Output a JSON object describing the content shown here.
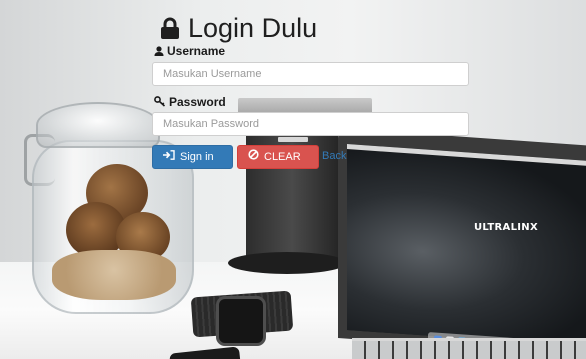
{
  "login": {
    "title": "Login Dulu",
    "title_icon": "lock-icon",
    "username": {
      "label": "Username",
      "icon": "user-icon",
      "placeholder": "Masukan Username",
      "value": ""
    },
    "password": {
      "label": "Password",
      "icon": "key-icon",
      "placeholder": "Masukan Password",
      "value": ""
    },
    "buttons": {
      "signin_label": "Sign in",
      "signin_icon": "sign-in-icon",
      "clear_label": "CLEAR",
      "clear_icon": "ban-icon",
      "back_label": "Back"
    }
  },
  "background": {
    "laptop_brand": "ULTRALINX"
  },
  "colors": {
    "primary": "#337ab7",
    "danger": "#d9534f",
    "text": "#1f1f1f"
  }
}
